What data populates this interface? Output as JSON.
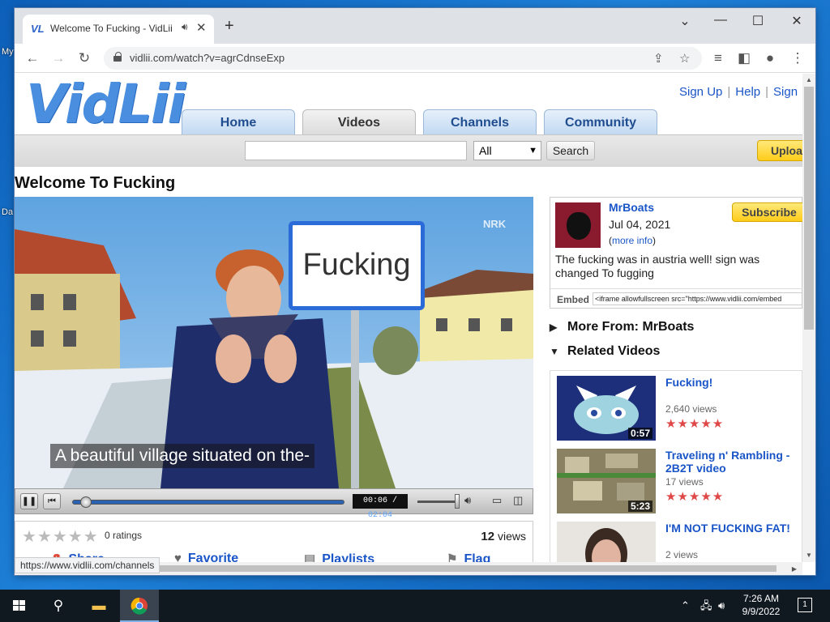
{
  "desktop": {
    "labels": [
      "My",
      "Da"
    ]
  },
  "browser": {
    "tab_title": "Welcome To Fucking - VidLii",
    "tab_favicon": "VL",
    "url": "vidlii.com/watch?v=agrCdnseExp",
    "status_url": "https://www.vidlii.com/channels"
  },
  "site": {
    "logo": "VidLii",
    "toplinks": [
      "Sign Up",
      "Help",
      "Sign"
    ],
    "nav": [
      "Home",
      "Videos",
      "Channels",
      "Community"
    ],
    "search_select": "All",
    "search_button": "Search",
    "upload_button": "Upload"
  },
  "video": {
    "title": "Welcome To Fucking",
    "sign_text": "Fucking",
    "watermark": "NRK",
    "caption": "A beautiful village situated on the-",
    "current_time": "00:06 / ",
    "total_time": "02:04",
    "progress": 0.05,
    "ratings": "0 ratings",
    "views_count": "12",
    "views_label": "views",
    "actions": [
      "Share",
      "Favorite",
      "Playlists",
      "Flag"
    ]
  },
  "uploader": {
    "name": "MrBoats",
    "date": "Jul 04, 2021",
    "more_open": "(",
    "more_link": "more info",
    "more_close": ")",
    "subscribe": "Subscribe",
    "description": "The fucking was in austria well! sign was changed To fugging",
    "embed_label": "Embed",
    "embed_code": "<iframe allowfullscreen src=\"https://www.vidlii.com/embed"
  },
  "sidebar": {
    "more_from": "More From: MrBoats",
    "related_title": "Related Videos",
    "related": [
      {
        "title": "Fucking!",
        "views": "2,640 views",
        "duration": "0:57",
        "stars": 5
      },
      {
        "title": "Traveling n' Rambling - 2B2T video",
        "views": "17 views",
        "duration": "5:23",
        "stars": 5
      },
      {
        "title": "I'M NOT FUCKING FAT!",
        "views": "2 views",
        "duration": "",
        "stars": 0
      }
    ]
  },
  "taskbar": {
    "time": "7:26 AM",
    "date": "9/9/2022",
    "notifications": "1"
  }
}
